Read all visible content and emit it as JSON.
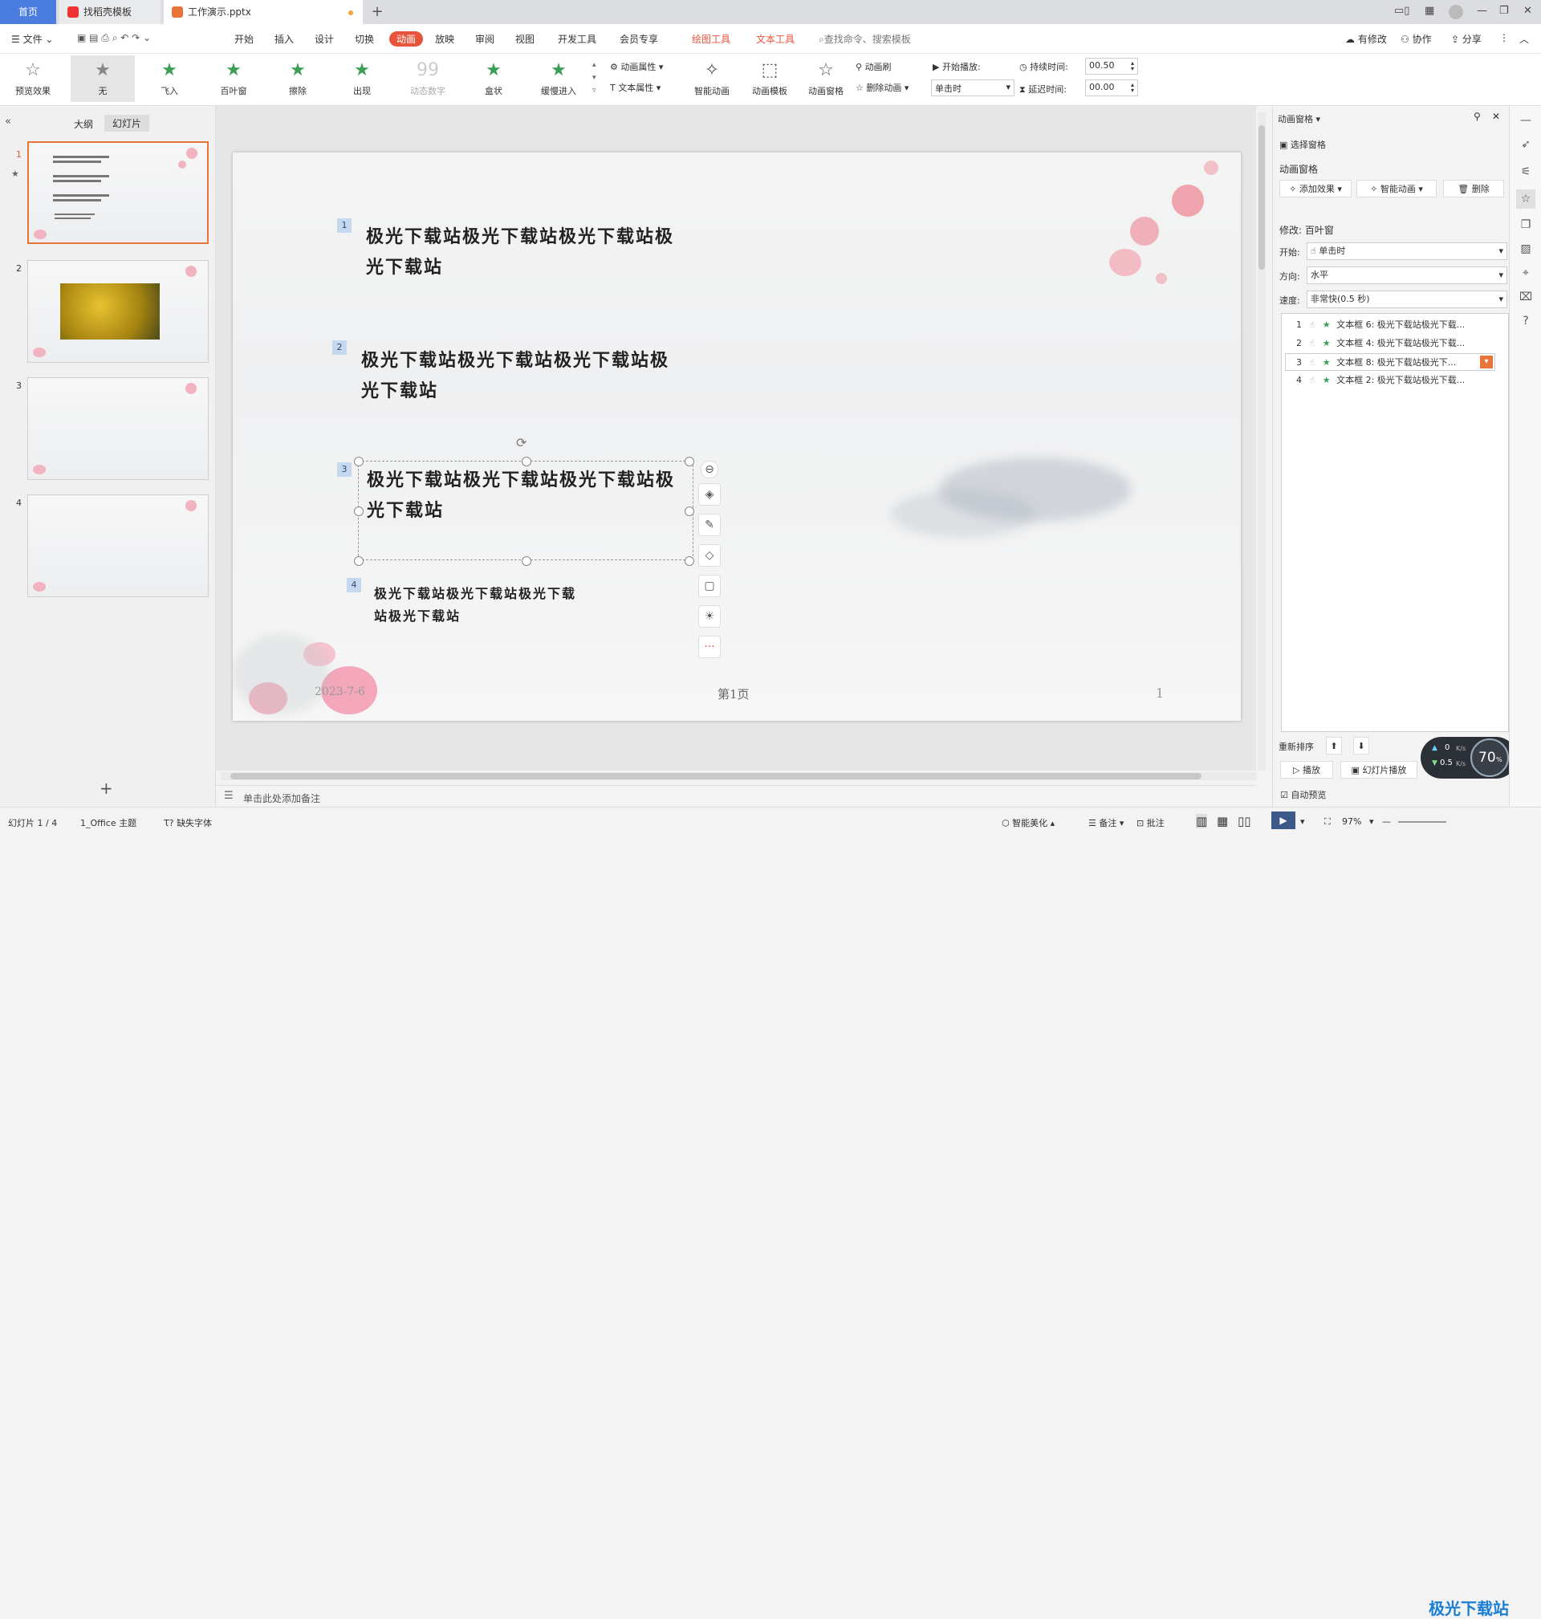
{
  "tabs": {
    "home": "首页",
    "template": "找稻壳模板",
    "file": "工作演示.pptx"
  },
  "menu": {
    "file": "文件",
    "items": [
      "开始",
      "插入",
      "设计",
      "切换",
      "动画",
      "放映",
      "审阅",
      "视图",
      "开发工具",
      "会员专享"
    ],
    "drawing_tools": "绘图工具",
    "text_tools": "文本工具",
    "search": "查找命令、搜索模板",
    "modified": "有修改",
    "collab": "协作",
    "share": "分享"
  },
  "ribbon": {
    "preview": "预览效果",
    "effects": [
      "无",
      "飞入",
      "百叶窗",
      "擦除",
      "出现",
      "动态数字",
      "盒状",
      "缓慢进入"
    ],
    "anim_props": "动画属性",
    "text_props": "文本属性",
    "smart_anim": "智能动画",
    "anim_template": "动画模板",
    "anim_pane": "动画窗格",
    "anim_brush": "动画刷",
    "delete_anim": "删除动画",
    "start_play": "开始播放:",
    "start_value": "单击时",
    "duration_label": "持续时间:",
    "duration_value": "00.50",
    "delay_label": "延迟时间:",
    "delay_value": "00.00"
  },
  "leftpanel": {
    "outline": "大纲",
    "slides": "幻灯片",
    "numbers": [
      "1",
      "2",
      "3",
      "4"
    ]
  },
  "slide": {
    "text1": "极光下载站极光下载站极光下载站极光下载站",
    "text2": "极光下载站极光下载站极光下载站极光下载站",
    "text3": "极光下载站极光下载站极光下载站极光下载站",
    "text4": "极光下载站极光下载站极光下载站极光下载站",
    "anim_nums": [
      "1",
      "2",
      "3",
      "4"
    ],
    "date": "2023-7-6",
    "footer": "第1页",
    "page": "1"
  },
  "notes": "单击此处添加备注",
  "rightpanel": {
    "title": "动画窗格",
    "select_pane": "选择窗格",
    "anim_pane": "动画窗格",
    "add_effect": "添加效果",
    "smart_anim": "智能动画",
    "delete": "删除",
    "modify": "修改: 百叶窗",
    "start_label": "开始:",
    "start_value": "单击时",
    "direction_label": "方向:",
    "direction_value": "水平",
    "speed_label": "速度:",
    "speed_value": "非常快(0.5 秒)",
    "list": [
      {
        "n": "1",
        "text": "文本框 6: 极光下载站极光下载..."
      },
      {
        "n": "2",
        "text": "文本框 4: 极光下载站极光下载..."
      },
      {
        "n": "3",
        "text": "文本框 8: 极光下载站极光下..."
      },
      {
        "n": "4",
        "text": "文本框 2: 极光下载站极光下载..."
      }
    ],
    "reorder": "重新排序",
    "play": "播放",
    "slideshow": "幻灯片播放",
    "auto_preview": "自动预览"
  },
  "netspeed": {
    "up": "0",
    "down": "0.5",
    "unit": "K/s",
    "percent": "70",
    "percent_unit": "%"
  },
  "status": {
    "slide": "幻灯片 1 / 4",
    "theme": "1_Office 主题",
    "missing_font": "缺失字体",
    "beautify": "智能美化",
    "notes": "备注",
    "comment": "批注",
    "zoom": "97%"
  },
  "watermark": "极光下载站",
  "colors": {
    "accent": "#e8543b",
    "home_tab": "#4a7ddf",
    "green_star": "#3a9e57"
  }
}
